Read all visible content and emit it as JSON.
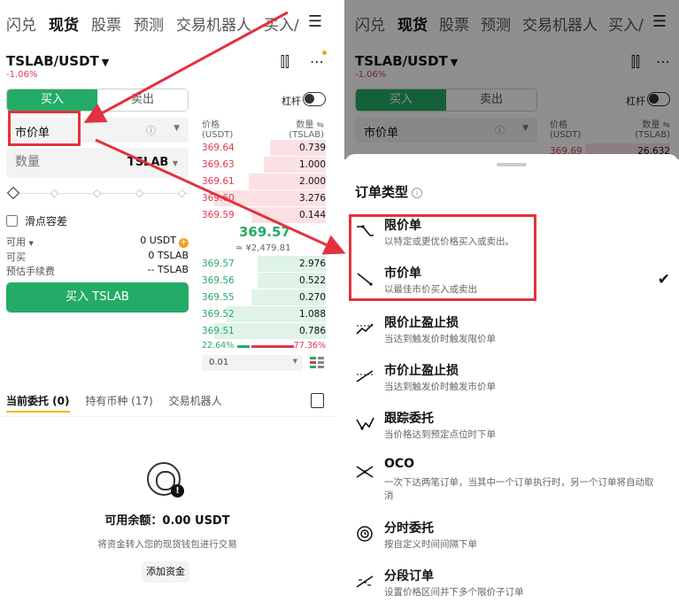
{
  "left": {
    "nav_tabs": [
      "闪兑",
      "现货",
      "股票",
      "预测",
      "交易机器人",
      "买入/́"
    ],
    "active_tab": "现货",
    "menu_icon": "hamburger-icon",
    "pair": "TSLAB/USDT",
    "change": "-1.06%",
    "buy_tab": "买入",
    "sell_tab": "卖出",
    "leverage_label": "杠杆",
    "order_type": "市价单",
    "qty_placeholder": "数量",
    "qty_unit": "TSLAB",
    "slippage": "滑点容差",
    "available_label": "可用",
    "available_value": "0 USDT",
    "sellable_label": "可买",
    "sellable_value": "0 TSLAB",
    "fee_label": "预估手续费",
    "fee_value": "-- TSLAB",
    "buy_button": "买入 TSLAB",
    "ob_price_header": "价格",
    "ob_price_unit": "(USDT)",
    "ob_qty_header": "数量",
    "ob_qty_unit": "(TSLAB)",
    "asks": [
      {
        "price": "369.64",
        "qty": "0.739",
        "depth": 0.45
      },
      {
        "price": "369.63",
        "qty": "1.000",
        "depth": 0.5
      },
      {
        "price": "369.61",
        "qty": "2.000",
        "depth": 0.62
      },
      {
        "price": "369.60",
        "qty": "3.276",
        "depth": 0.9
      },
      {
        "price": "369.59",
        "qty": "0.144",
        "depth": 0.6
      }
    ],
    "last_price": "369.57",
    "last_price_cny": "≈ ¥2,479.81",
    "bids": [
      {
        "price": "369.57",
        "qty": "2.976",
        "depth": 0.55
      },
      {
        "price": "369.56",
        "qty": "0.522",
        "depth": 0.55
      },
      {
        "price": "369.55",
        "qty": "0.270",
        "depth": 0.6
      },
      {
        "price": "369.52",
        "qty": "1.088",
        "depth": 0.8
      },
      {
        "price": "369.51",
        "qty": "0.786",
        "depth": 0.9
      }
    ],
    "buy_ratio": "22.64%",
    "sell_ratio": "77.36%",
    "precision": "0.01",
    "bottom_tabs": [
      "当前委托 (0)",
      "持有币种 (17)",
      "交易机器人"
    ],
    "balance": "可用余额：0.00 USDT",
    "balance_desc": "将资金转入您的现货钱包进行交易",
    "add_funds": "添加资金"
  },
  "right": {
    "nav_tabs": [
      "闪兑",
      "现货",
      "股票",
      "预测",
      "交易机器人",
      "买入/"
    ],
    "pair": "TSLAB/USDT",
    "change": "-1.06%",
    "buy_tab": "买入",
    "sell_tab": "卖出",
    "leverage_label": "杠杆",
    "order_type": "市价单",
    "ob_price_header": "价格",
    "ob_price_unit": "(USDT)",
    "ob_qty_header": "数量",
    "ob_qty_unit": "(TSLAB)",
    "top_ask_price": "369.69",
    "top_ask_qty": "26.632",
    "sheet_title": "订单类型",
    "options": [
      {
        "title": "限价单",
        "desc": "以特定或更优价格买入或卖出。",
        "icon": "limit-order-icon"
      },
      {
        "title": "市价单",
        "desc": "以最佳市价买入或卖出",
        "icon": "market-order-icon",
        "selected": true
      },
      {
        "title": "限价止盈止损",
        "desc": "当达到触发价时触发限价单",
        "icon": "limit-tpsl-icon"
      },
      {
        "title": "市价止盈止损",
        "desc": "当达到触发价时触发市价单",
        "icon": "market-tpsl-icon"
      },
      {
        "title": "跟踪委托",
        "desc": "当价格达到预定点位时下单",
        "icon": "trailing-order-icon"
      },
      {
        "title": "OCO",
        "desc": "一次下达两笔订单，当其中一个订单执行时，另一个订单将自动取消",
        "icon": "oco-icon"
      },
      {
        "title": "分时委托",
        "desc": "按自定义时间间隔下单",
        "icon": "twap-clock-icon"
      },
      {
        "title": "分段订单",
        "desc": "设置价格区间并下多个限价子订单",
        "icon": "scaled-order-icon"
      }
    ]
  },
  "colors": {
    "green": "#24ab67",
    "red": "#e0384e",
    "annotation": "#e2323f"
  }
}
